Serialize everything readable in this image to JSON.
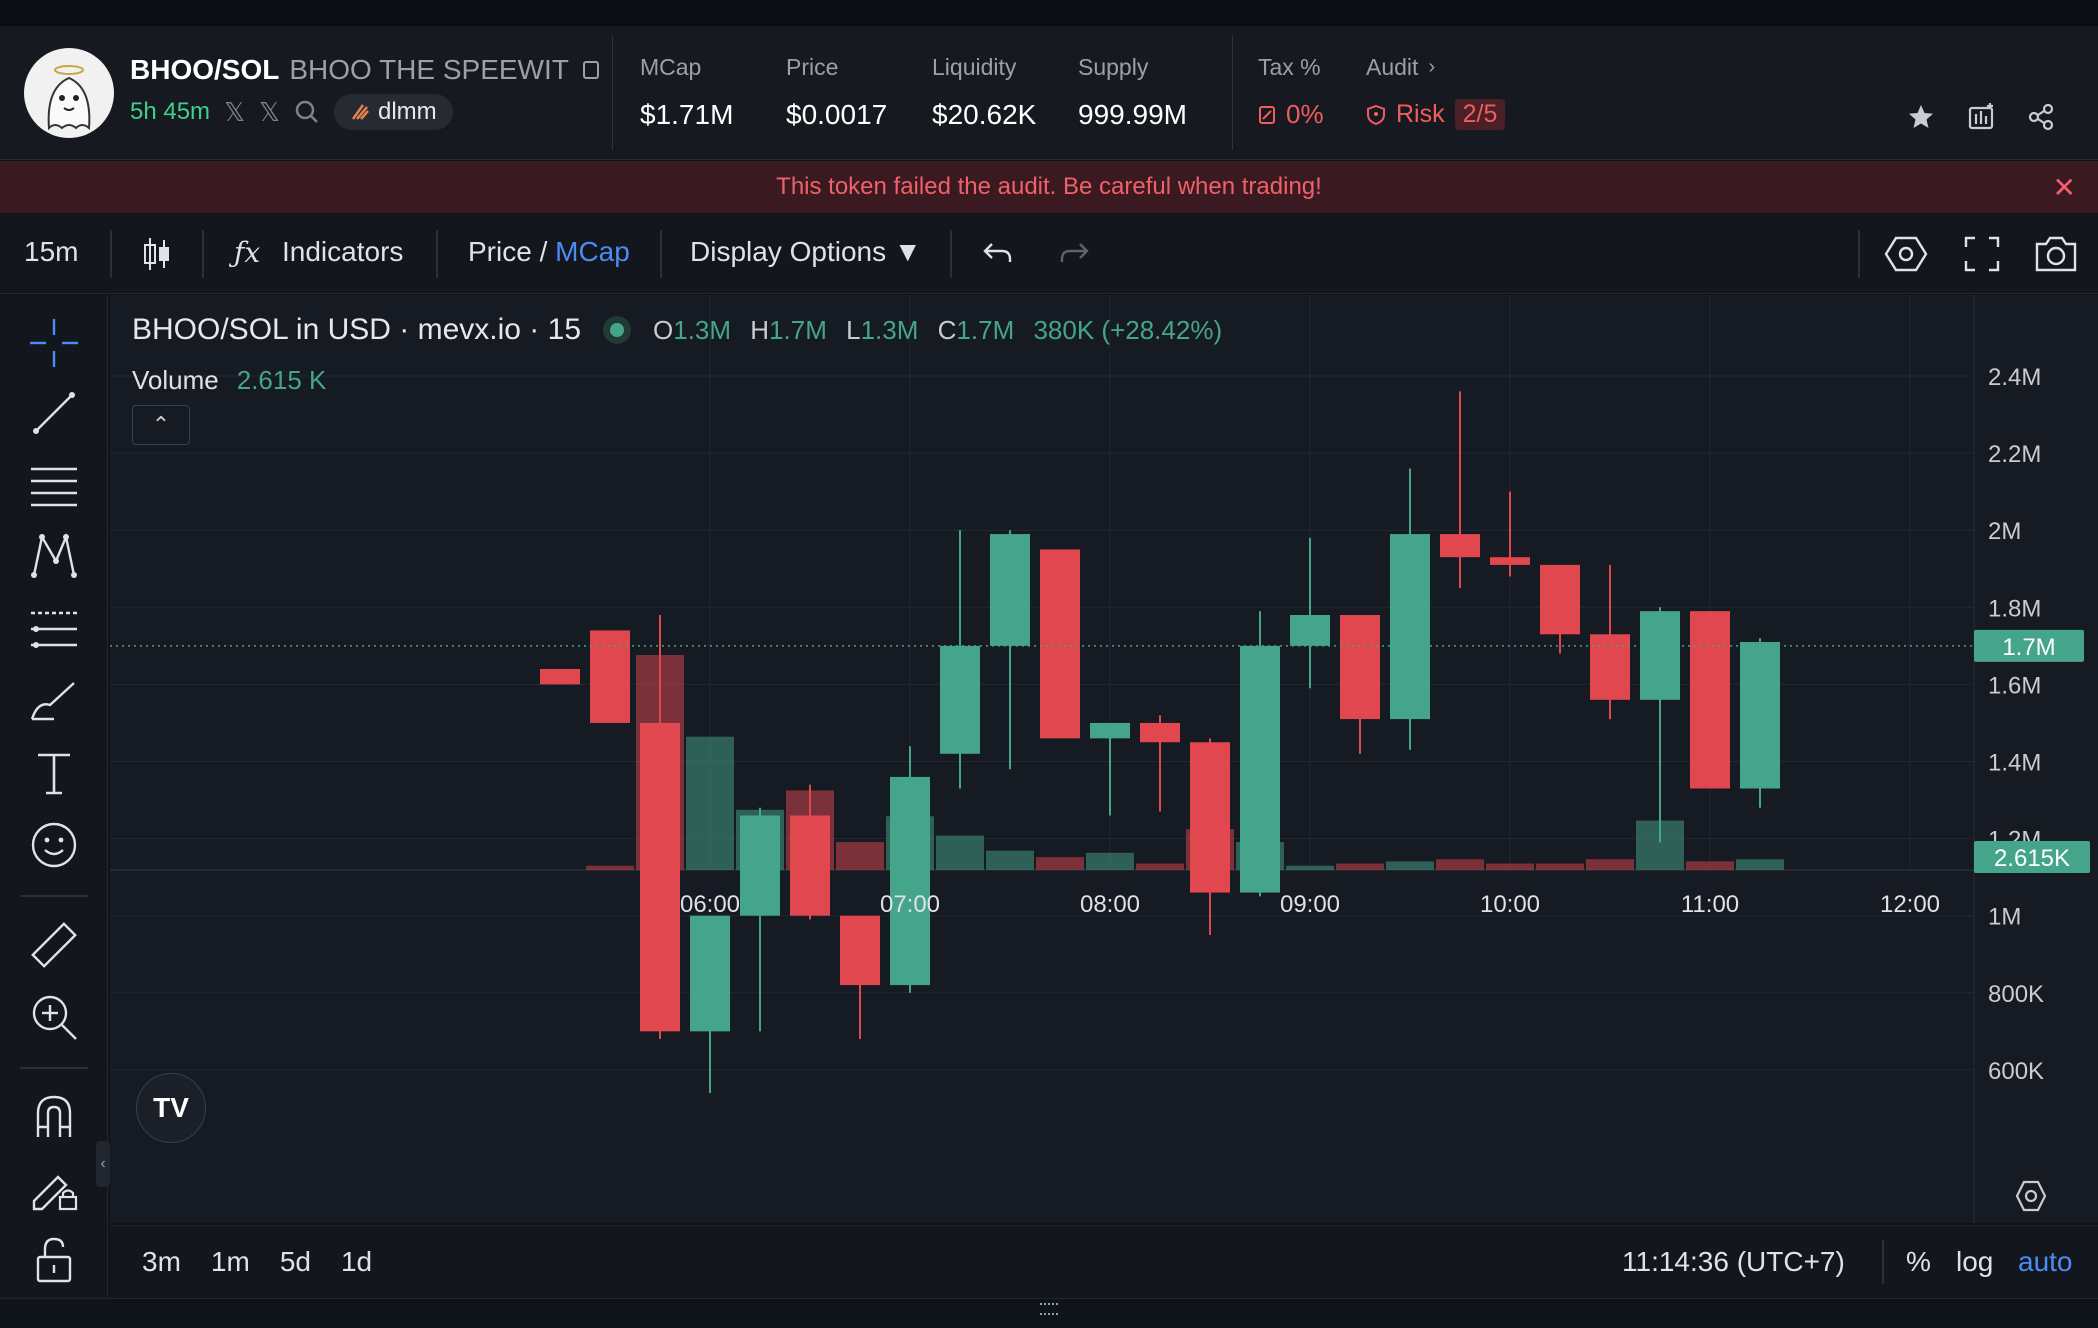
{
  "token": {
    "symbol": "BHOO/SOL",
    "name": "BHOO THE SPEEWIT",
    "age": "5h 45m",
    "tag": "dlmm"
  },
  "stats": {
    "mcap_label": "MCap",
    "mcap": "$1.71M",
    "price_label": "Price",
    "price": "$0.0017",
    "liq_label": "Liquidity",
    "liq": "$20.62K",
    "supply_label": "Supply",
    "supply": "999.99M",
    "tax_label": "Tax %",
    "tax": "0%",
    "audit_label": "Audit",
    "risk_label": "Risk",
    "risk_score": "2/5"
  },
  "alert": "This token failed the audit. Be careful when trading!",
  "toolbar": {
    "interval": "15m",
    "indicators": "Indicators",
    "price_label": "Price",
    "slash": " / ",
    "mcap_label": "MCap",
    "display_options": "Display Options ▼"
  },
  "legend": {
    "title": "BHOO/SOL in USD · mevx.io · 15",
    "o_label": "O",
    "o": "1.3M",
    "h_label": "H",
    "h": "1.7M",
    "l_label": "L",
    "l": "1.3M",
    "c_label": "C",
    "c": "1.7M",
    "change": "380K (+28.42%)",
    "volume_label": "Volume",
    "volume": "2.615 K"
  },
  "bottombar": {
    "ranges": [
      "3m",
      "1m",
      "5d",
      "1d"
    ],
    "time": "11:14:36 (UTC+7)",
    "pct": "%",
    "log": "log",
    "auto": "auto"
  },
  "colors": {
    "up": "#45a58a",
    "down": "#e0474f",
    "accent": "#4c8bf5"
  },
  "chart_data": {
    "type": "candlestick",
    "yticks": [
      "2.4M",
      "2.2M",
      "2M",
      "1.8M",
      "1.6M",
      "1.4M",
      "1.2M",
      "1M",
      "800K",
      "600K"
    ],
    "ytick_values": [
      2400000,
      2200000,
      2000000,
      1800000,
      1600000,
      1400000,
      1200000,
      1000000,
      800000,
      600000
    ],
    "xticks": [
      "06:00",
      "07:00",
      "08:00",
      "09:00",
      "10:00",
      "11:00",
      "12:00"
    ],
    "current_price_label": "1.7M",
    "current_price": 1700000,
    "current_volume_label": "2.615K",
    "candles": [
      {
        "t": "05:15",
        "o": 1640000,
        "h": 1640000,
        "l": 1600000,
        "c": 1600000
      },
      {
        "t": "05:30",
        "o": 1740000,
        "h": 1740000,
        "l": 1500000,
        "c": 1500000
      },
      {
        "t": "05:45",
        "o": 1500000,
        "h": 1780000,
        "l": 680000,
        "c": 700000
      },
      {
        "t": "06:00",
        "o": 700000,
        "h": 1000000,
        "l": 540000,
        "c": 1000000
      },
      {
        "t": "06:15",
        "o": 1000000,
        "h": 1280000,
        "l": 700000,
        "c": 1260000
      },
      {
        "t": "06:30",
        "o": 1260000,
        "h": 1340000,
        "l": 990000,
        "c": 1000000
      },
      {
        "t": "06:45",
        "o": 1000000,
        "h": 1000000,
        "l": 680000,
        "c": 820000
      },
      {
        "t": "07:00",
        "o": 820000,
        "h": 1440000,
        "l": 800000,
        "c": 1360000
      },
      {
        "t": "07:15",
        "o": 1420000,
        "h": 2000000,
        "l": 1330000,
        "c": 1700000
      },
      {
        "t": "07:30",
        "o": 1700000,
        "h": 2000000,
        "l": 1380000,
        "c": 1990000
      },
      {
        "t": "07:45",
        "o": 1950000,
        "h": 1950000,
        "l": 1460000,
        "c": 1460000
      },
      {
        "t": "08:00",
        "o": 1460000,
        "h": 1480000,
        "l": 1260000,
        "c": 1500000
      },
      {
        "t": "08:15",
        "o": 1500000,
        "h": 1520000,
        "l": 1270000,
        "c": 1450000
      },
      {
        "t": "08:30",
        "o": 1450000,
        "h": 1460000,
        "l": 950000,
        "c": 1060000
      },
      {
        "t": "08:45",
        "o": 1060000,
        "h": 1790000,
        "l": 1050000,
        "c": 1700000
      },
      {
        "t": "09:00",
        "o": 1700000,
        "h": 1980000,
        "l": 1590000,
        "c": 1780000
      },
      {
        "t": "09:15",
        "o": 1780000,
        "h": 1780000,
        "l": 1420000,
        "c": 1510000
      },
      {
        "t": "09:30",
        "o": 1510000,
        "h": 2160000,
        "l": 1430000,
        "c": 1990000
      },
      {
        "t": "09:45",
        "o": 1990000,
        "h": 2360000,
        "l": 1850000,
        "c": 1930000
      },
      {
        "t": "10:00",
        "o": 1930000,
        "h": 2100000,
        "l": 1880000,
        "c": 1910000
      },
      {
        "t": "10:15",
        "o": 1910000,
        "h": 1910000,
        "l": 1680000,
        "c": 1730000
      },
      {
        "t": "10:30",
        "o": 1730000,
        "h": 1910000,
        "l": 1510000,
        "c": 1560000
      },
      {
        "t": "10:45",
        "o": 1560000,
        "h": 1800000,
        "l": 1190000,
        "c": 1790000
      },
      {
        "t": "11:00",
        "o": 1790000,
        "h": 1790000,
        "l": 1330000,
        "c": 1330000
      },
      {
        "t": "11:15",
        "o": 1330000,
        "h": 1720000,
        "l": 1280000,
        "c": 1710000
      }
    ],
    "volumes": [
      {
        "t": "05:30",
        "v": 0.02,
        "up": false
      },
      {
        "t": "05:45",
        "v": 1.0,
        "up": false
      },
      {
        "t": "06:00",
        "v": 0.62,
        "up": true
      },
      {
        "t": "06:15",
        "v": 0.28,
        "up": true
      },
      {
        "t": "06:30",
        "v": 0.37,
        "up": false
      },
      {
        "t": "06:45",
        "v": 0.13,
        "up": false
      },
      {
        "t": "07:00",
        "v": 0.25,
        "up": true
      },
      {
        "t": "07:15",
        "v": 0.16,
        "up": true
      },
      {
        "t": "07:30",
        "v": 0.09,
        "up": true
      },
      {
        "t": "07:45",
        "v": 0.06,
        "up": false
      },
      {
        "t": "08:00",
        "v": 0.08,
        "up": true
      },
      {
        "t": "08:15",
        "v": 0.03,
        "up": false
      },
      {
        "t": "08:30",
        "v": 0.19,
        "up": false
      },
      {
        "t": "08:45",
        "v": 0.13,
        "up": true
      },
      {
        "t": "09:00",
        "v": 0.02,
        "up": true
      },
      {
        "t": "09:15",
        "v": 0.03,
        "up": false
      },
      {
        "t": "09:30",
        "v": 0.04,
        "up": true
      },
      {
        "t": "09:45",
        "v": 0.05,
        "up": false
      },
      {
        "t": "10:00",
        "v": 0.03,
        "up": false
      },
      {
        "t": "10:15",
        "v": 0.03,
        "up": false
      },
      {
        "t": "10:30",
        "v": 0.05,
        "up": false
      },
      {
        "t": "10:45",
        "v": 0.23,
        "up": true
      },
      {
        "t": "11:00",
        "v": 0.04,
        "up": false
      },
      {
        "t": "11:15",
        "v": 0.05,
        "up": true
      }
    ]
  }
}
